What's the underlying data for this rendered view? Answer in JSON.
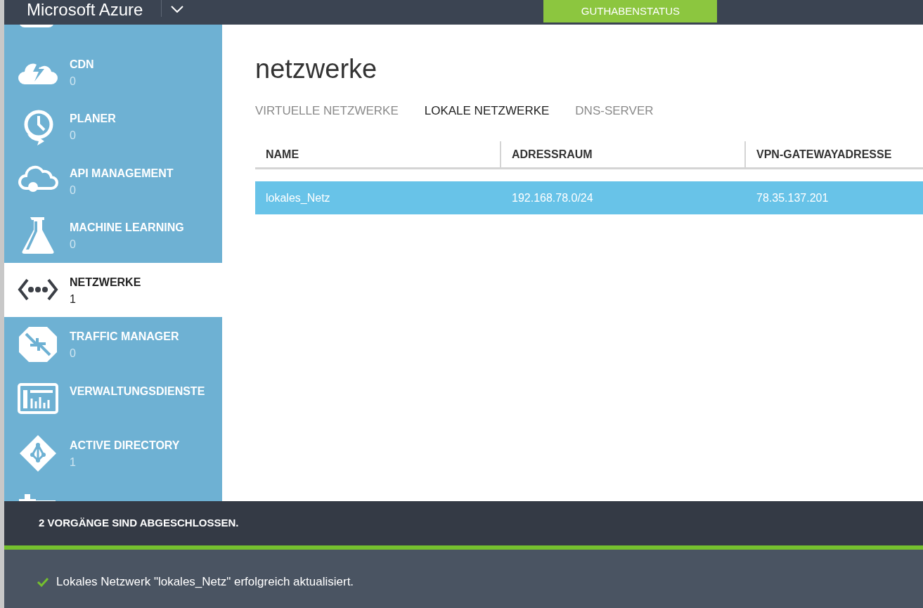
{
  "header": {
    "brand": "Microsoft Azure",
    "credit_button": "GUTHABENSTATUS"
  },
  "sidebar": {
    "items": [
      {
        "kind": "storage",
        "selected": false
      },
      {
        "kind": "cdn",
        "title": "CDN",
        "count": "0",
        "selected": false
      },
      {
        "kind": "scheduler",
        "title": "PLANER",
        "count": "0",
        "selected": false
      },
      {
        "kind": "api",
        "title": "API MANAGEMENT",
        "count": "0",
        "selected": false
      },
      {
        "kind": "ml",
        "title": "MACHINE LEARNING",
        "count": "0",
        "selected": false
      },
      {
        "kind": "network",
        "title": "NETZWERKE",
        "count": "1",
        "selected": true
      },
      {
        "kind": "traffic",
        "title": "TRAFFIC MANAGER",
        "count": "0",
        "selected": false
      },
      {
        "kind": "management",
        "title": "VERWALTUNGSDIENSTE",
        "selected": false
      },
      {
        "kind": "directory",
        "title": "ACTIVE DIRECTORY",
        "count": "1",
        "selected": false
      },
      {
        "kind": "addons",
        "selected": false
      }
    ]
  },
  "page": {
    "title": "netzwerke",
    "tabs": [
      {
        "label": "VIRTUELLE NETZWERKE",
        "selected": false
      },
      {
        "label": "LOKALE NETZWERKE",
        "selected": true
      },
      {
        "label": "DNS-SERVER",
        "selected": false
      }
    ],
    "table": {
      "columns": [
        "NAME",
        "ADRESSRAUM",
        "VPN-GATEWAYADRESSE"
      ],
      "rows": [
        {
          "cells": [
            "lokales_Netz",
            "192.168.78.0/24",
            "78.35.137.201"
          ],
          "selected": true
        }
      ]
    }
  },
  "notifications": {
    "summary": "2 VORGÄNGE SIND ABGESCHLOSSEN.",
    "items": [
      {
        "text": "Lokales Netzwerk \"lokales_Netz\" erfolgreich aktualisiert.",
        "kind": "success"
      }
    ]
  }
}
